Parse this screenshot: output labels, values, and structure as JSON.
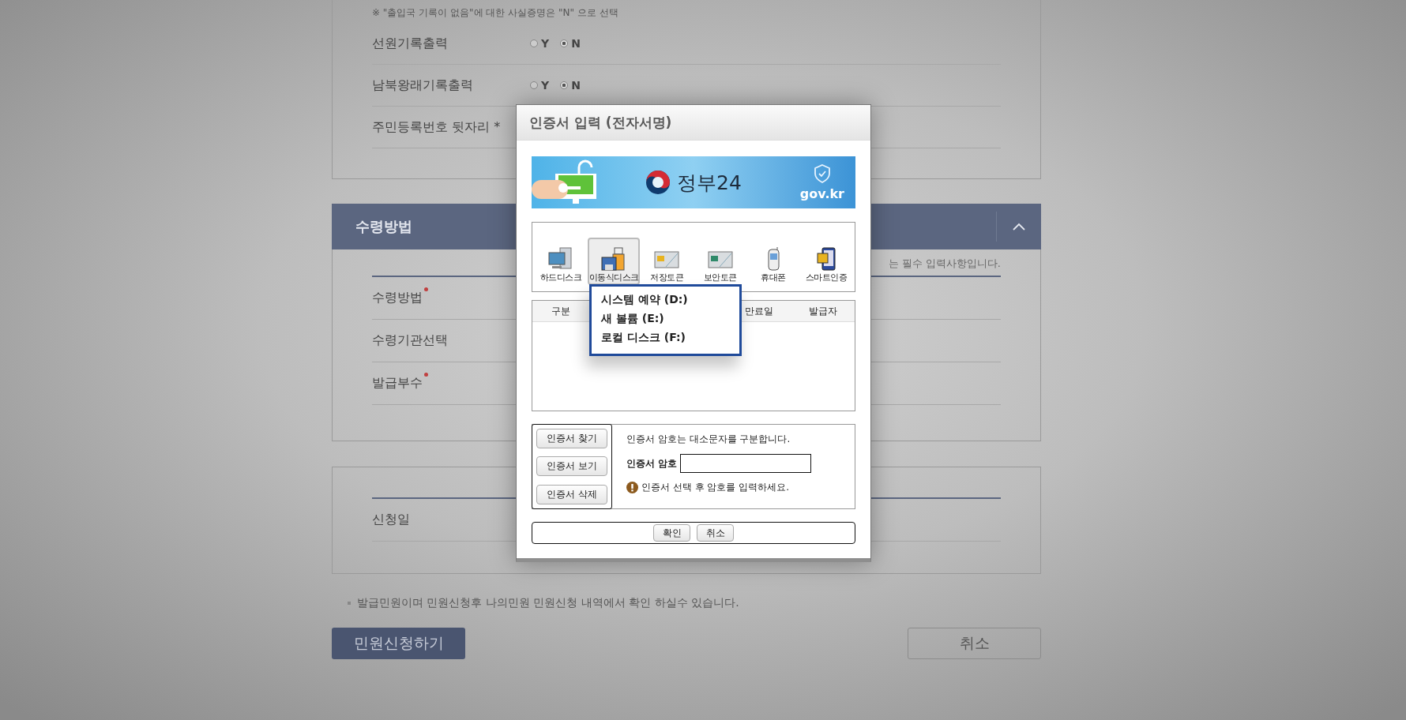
{
  "page": {
    "notice": "※ \"출입국 기록이 없음\"에 대한 사실증명은 \"N\" 으로 선택",
    "options": [
      {
        "label": "선원기록출력",
        "choices": [
          {
            "label": "Y",
            "selected": false
          },
          {
            "label": "N",
            "selected": true
          }
        ]
      },
      {
        "label": "남북왕래기록출력",
        "choices": [
          {
            "label": "Y",
            "selected": false
          },
          {
            "label": "N",
            "selected": true
          }
        ]
      }
    ],
    "resident_label": "주민등록번호 뒷자리 *",
    "receipt_section": {
      "title": "수령방법",
      "expanded": true,
      "hint": "는 필수 입력사항입니다.",
      "rows": [
        {
          "label": "수령방법",
          "required": true
        },
        {
          "label": "수령기관선택",
          "required": false
        },
        {
          "label": "발급부수",
          "required": true
        }
      ]
    },
    "date_label": "신청일",
    "footnote": "발급민원이며 민원신청후 나의민원 민원신청 내역에서 확인 하실수 있습니다.",
    "submit_button": "민원신청하기",
    "cancel_button": "취소"
  },
  "dialog": {
    "title": "인증서 입력 (전자서명)",
    "banner": {
      "brand": "정부24",
      "domain": "gov.kr"
    },
    "storage_tabs": [
      {
        "label": "하드디스크",
        "kind": "hdd",
        "selected": false
      },
      {
        "label": "이동식디스크",
        "kind": "removable",
        "selected": true
      },
      {
        "label": "저장토큰",
        "kind": "token",
        "selected": false
      },
      {
        "label": "보안토큰",
        "kind": "secure",
        "selected": false
      },
      {
        "label": "휴대폰",
        "kind": "phone",
        "selected": false
      },
      {
        "label": "스마트인증",
        "kind": "smart",
        "selected": false
      }
    ],
    "drive_menu": [
      "시스템 예약 (D:)",
      "새 볼륨 (E:)",
      "로컬 디스크 (F:)"
    ],
    "table": {
      "columns": [
        "구분",
        "만료일",
        "발급자"
      ]
    },
    "cert_buttons": [
      "인증서 찾기",
      "인증서 보기",
      "인증서 삭제"
    ],
    "case_notice": "인증서 암호는 대소문자를 구분합니다.",
    "password_label": "인증서 암호",
    "warning": "인증서 선택 후 암호를 입력하세요.",
    "buttons": [
      "확인",
      "취소"
    ]
  }
}
